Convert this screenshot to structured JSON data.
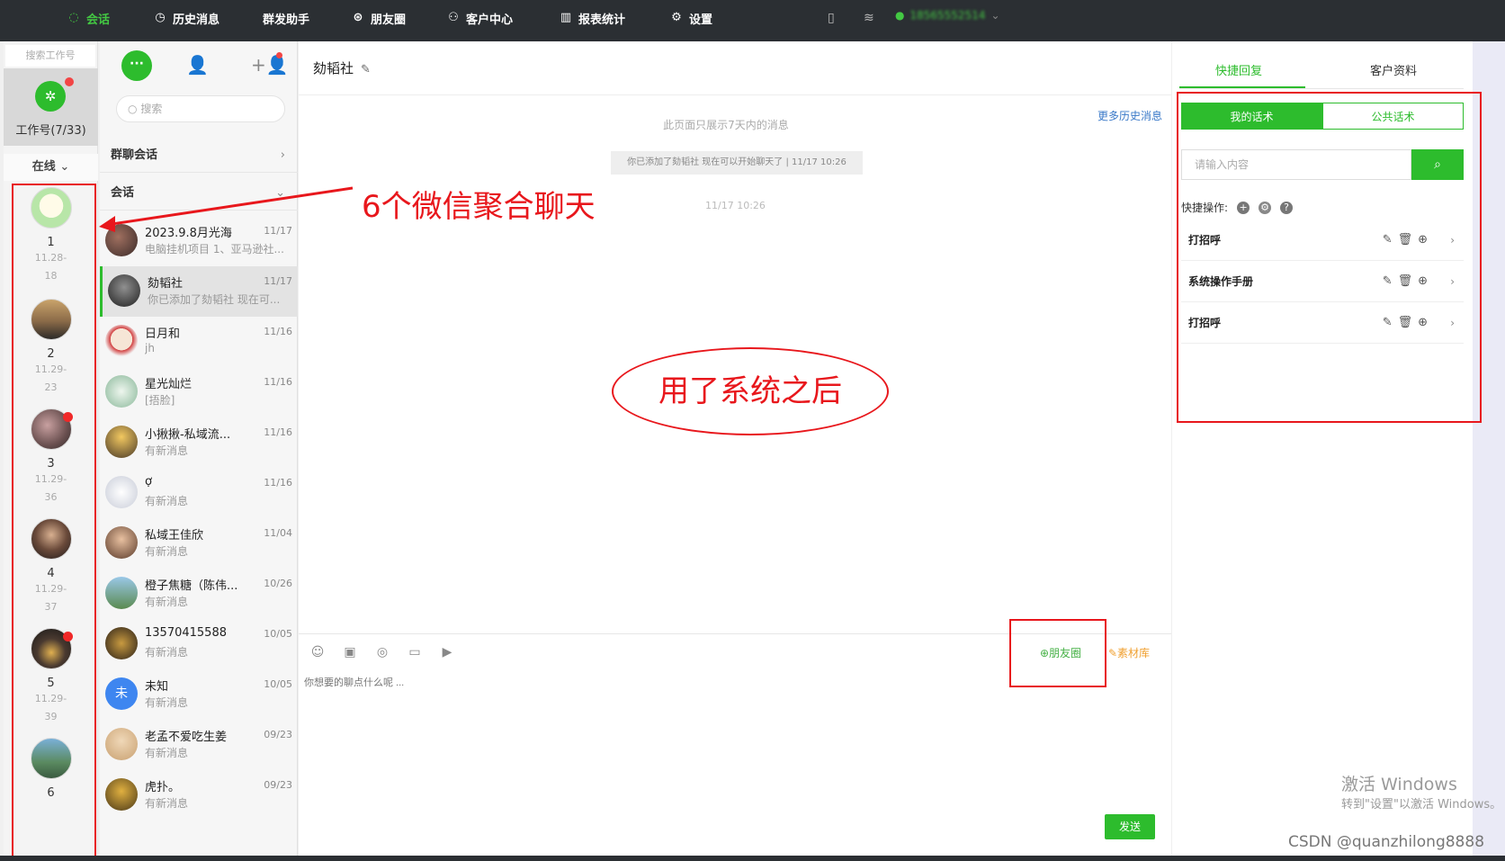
{
  "nav": {
    "items": [
      {
        "label": "会话",
        "icon": "chat-icon",
        "active": true
      },
      {
        "label": "历史消息",
        "icon": "clock-icon"
      },
      {
        "label": "群发助手",
        "icon": ""
      },
      {
        "label": "朋友圈",
        "icon": "aperture-icon"
      },
      {
        "label": "客户中心",
        "icon": "user-icon"
      },
      {
        "label": "报表统计",
        "icon": "bar-chart-icon"
      },
      {
        "label": "设置",
        "icon": "gear-icon"
      }
    ],
    "phone": "18565552514"
  },
  "accounts": {
    "search_placeholder": "搜索工作号",
    "tile_label": "工作号(7/33)",
    "status_filter": "在线",
    "list": [
      {
        "num": "1",
        "date1": "11.28-",
        "date2": "18"
      },
      {
        "num": "2",
        "date1": "11.29-",
        "date2": "23"
      },
      {
        "num": "3",
        "date1": "11.29-",
        "date2": "36"
      },
      {
        "num": "4",
        "date1": "11.29-",
        "date2": "37"
      },
      {
        "num": "5",
        "date1": "11.29-",
        "date2": "39"
      },
      {
        "num": "6",
        "date1": "",
        "date2": ""
      }
    ]
  },
  "conversations": {
    "search_placeholder": "搜索",
    "group_label": "群聊会话",
    "session_label": "会话",
    "items": [
      {
        "name": "2023.9.8月光海",
        "preview": "电脑挂机项目 1、亚马逊社...",
        "time": "11/17"
      },
      {
        "name": "劾韬社",
        "preview": "你已添加了劾韬社 现在可...",
        "time": "11/17"
      },
      {
        "name": "日月和",
        "preview": "jh",
        "time": "11/16"
      },
      {
        "name": "星光灿烂",
        "preview": "[捂脸]",
        "time": "11/16"
      },
      {
        "name": "小揪揪-私域流...",
        "preview": "有新消息",
        "time": "11/16"
      },
      {
        "name": "ợ",
        "preview": "有新消息",
        "time": "11/16"
      },
      {
        "name": "私域王佳欣",
        "preview": "有新消息",
        "time": "11/04"
      },
      {
        "name": "橙子焦糖（陈伟...",
        "preview": "有新消息",
        "time": "10/26"
      },
      {
        "name": "13570415588",
        "preview": "有新消息",
        "time": "10/05"
      },
      {
        "name": "未知",
        "preview": "有新消息",
        "time": "10/05",
        "avatar_text": "未"
      },
      {
        "name": "老孟不爱吃生姜",
        "preview": "有新消息",
        "time": "09/23"
      },
      {
        "name": "虎扑。",
        "preview": "有新消息",
        "time": "09/23"
      }
    ]
  },
  "chat": {
    "title": "劾韬社",
    "more_history": "更多历史消息",
    "notice": "此页面只展示7天内的消息",
    "system_msg": "你已添加了劾韬社 现在可以开始聊天了 | 11/17 10:26",
    "timestamp": "11/17 10:26",
    "moments_link": "⊕朋友圈",
    "material_link": "✎素材库",
    "input_placeholder": "你想要的聊点什么呢 ...",
    "send_label": "发送"
  },
  "right_panel": {
    "tabs": [
      "快捷回复",
      "客户资料"
    ],
    "segments": [
      "我的话术",
      "公共话术"
    ],
    "search_placeholder": "请输入内容",
    "quick_ops_label": "快捷操作:",
    "replies": [
      "打招呼",
      "系统操作手册",
      "打招呼"
    ]
  },
  "annotations": {
    "aggregate_text": "6个微信聚合聊天",
    "after_text": "用了系统之后"
  },
  "watermark": {
    "line1": "激活 Windows",
    "line2": "转到\"设置\"以激活 Windows。",
    "csdn": "CSDN @quanzhilong8888"
  }
}
